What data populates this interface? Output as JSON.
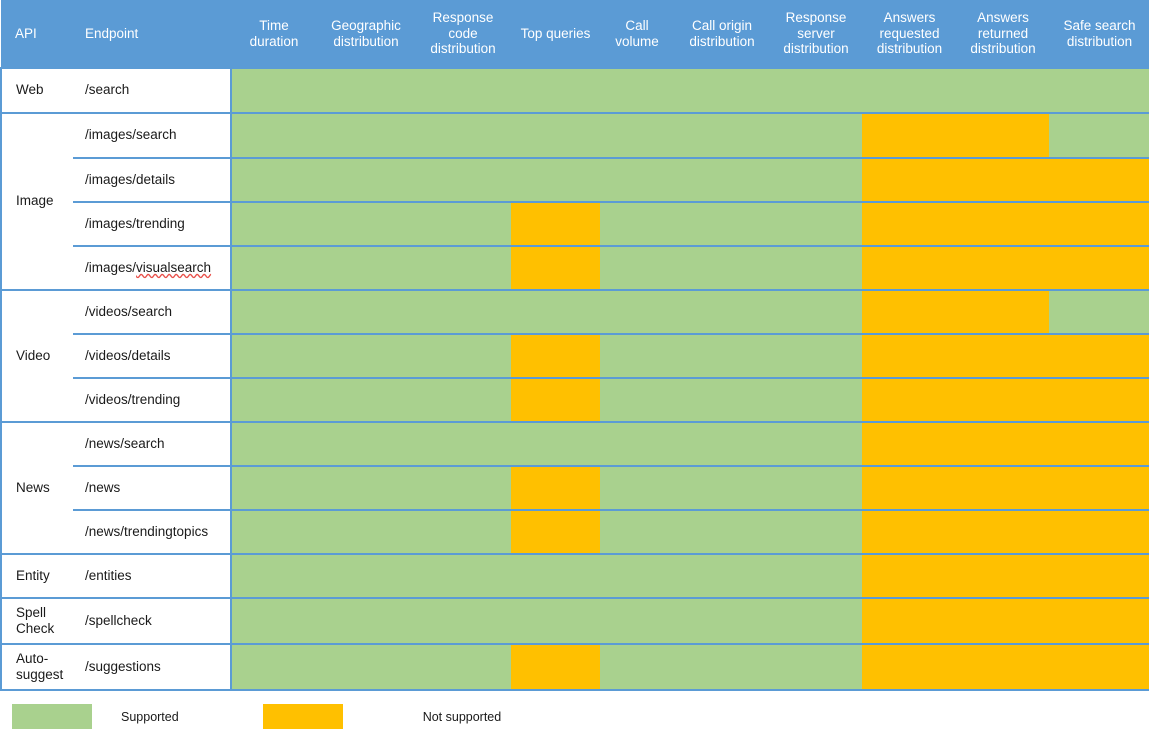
{
  "table": {
    "headers": {
      "api": "API",
      "endpoint": "Endpoint",
      "metrics": [
        "Time duration",
        "Geographic distribution",
        "Response code distribution",
        "Top queries",
        "Call volume",
        "Call origin distribution",
        "Response server distribution",
        "Answers requested distribution",
        "Answers returned distribution",
        "Safe search distribution"
      ]
    },
    "groups": [
      {
        "api": "Web",
        "rows": [
          {
            "endpoint": "/search",
            "misspelled": false,
            "support": [
              "supported",
              "supported",
              "supported",
              "supported",
              "supported",
              "supported",
              "supported",
              "supported",
              "supported",
              "supported"
            ]
          }
        ]
      },
      {
        "api": "Image",
        "rows": [
          {
            "endpoint": "/images/search",
            "misspelled": false,
            "support": [
              "supported",
              "supported",
              "supported",
              "supported",
              "supported",
              "supported",
              "supported",
              "unsupported",
              "unsupported",
              "supported"
            ]
          },
          {
            "endpoint": "/images/details",
            "misspelled": false,
            "support": [
              "supported",
              "supported",
              "supported",
              "supported",
              "supported",
              "supported",
              "supported",
              "unsupported",
              "unsupported",
              "unsupported"
            ]
          },
          {
            "endpoint": "/images/trending",
            "misspelled": false,
            "support": [
              "supported",
              "supported",
              "supported",
              "unsupported",
              "supported",
              "supported",
              "supported",
              "unsupported",
              "unsupported",
              "unsupported"
            ]
          },
          {
            "endpoint": "/images/visualsearch",
            "misspelled": true,
            "misspelled_prefix": "/images/",
            "misspelled_word": "visualsearch",
            "support": [
              "supported",
              "supported",
              "supported",
              "unsupported",
              "supported",
              "supported",
              "supported",
              "unsupported",
              "unsupported",
              "unsupported"
            ]
          }
        ]
      },
      {
        "api": "Video",
        "rows": [
          {
            "endpoint": "/videos/search",
            "misspelled": false,
            "support": [
              "supported",
              "supported",
              "supported",
              "supported",
              "supported",
              "supported",
              "supported",
              "unsupported",
              "unsupported",
              "supported"
            ]
          },
          {
            "endpoint": "/videos/details",
            "misspelled": false,
            "support": [
              "supported",
              "supported",
              "supported",
              "unsupported",
              "supported",
              "supported",
              "supported",
              "unsupported",
              "unsupported",
              "unsupported"
            ]
          },
          {
            "endpoint": "/videos/trending",
            "misspelled": false,
            "support": [
              "supported",
              "supported",
              "supported",
              "unsupported",
              "supported",
              "supported",
              "supported",
              "unsupported",
              "unsupported",
              "unsupported"
            ]
          }
        ]
      },
      {
        "api": "News",
        "rows": [
          {
            "endpoint": "/news/search",
            "misspelled": false,
            "support": [
              "supported",
              "supported",
              "supported",
              "supported",
              "supported",
              "supported",
              "supported",
              "unsupported",
              "unsupported",
              "unsupported"
            ]
          },
          {
            "endpoint": "/news",
            "misspelled": false,
            "support": [
              "supported",
              "supported",
              "supported",
              "unsupported",
              "supported",
              "supported",
              "supported",
              "unsupported",
              "unsupported",
              "unsupported"
            ]
          },
          {
            "endpoint": "/news/trendingtopics",
            "misspelled": false,
            "support": [
              "supported",
              "supported",
              "supported",
              "unsupported",
              "supported",
              "supported",
              "supported",
              "unsupported",
              "unsupported",
              "unsupported"
            ]
          }
        ]
      },
      {
        "api": "Entity",
        "rows": [
          {
            "endpoint": "/entities",
            "misspelled": false,
            "support": [
              "supported",
              "supported",
              "supported",
              "supported",
              "supported",
              "supported",
              "supported",
              "unsupported",
              "unsupported",
              "unsupported"
            ]
          }
        ]
      },
      {
        "api": "Spell Check",
        "rows": [
          {
            "endpoint": "/spellcheck",
            "misspelled": false,
            "support": [
              "supported",
              "supported",
              "supported",
              "supported",
              "supported",
              "supported",
              "supported",
              "unsupported",
              "unsupported",
              "unsupported"
            ]
          }
        ]
      },
      {
        "api": "Auto-suggest",
        "rows": [
          {
            "endpoint": "/suggestions",
            "misspelled": false,
            "support": [
              "supported",
              "supported",
              "supported",
              "unsupported",
              "supported",
              "supported",
              "supported",
              "unsupported",
              "unsupported",
              "unsupported"
            ]
          }
        ]
      }
    ]
  },
  "legend": {
    "supported_label": "Supported",
    "not_supported_label": "Not supported"
  },
  "colors": {
    "header_blue": "#5B9BD5",
    "supported_green": "#A9D18E",
    "not_supported_orange": "#FFC000",
    "grid_line": "#5B9BD5",
    "text": "#1a1a1a"
  }
}
